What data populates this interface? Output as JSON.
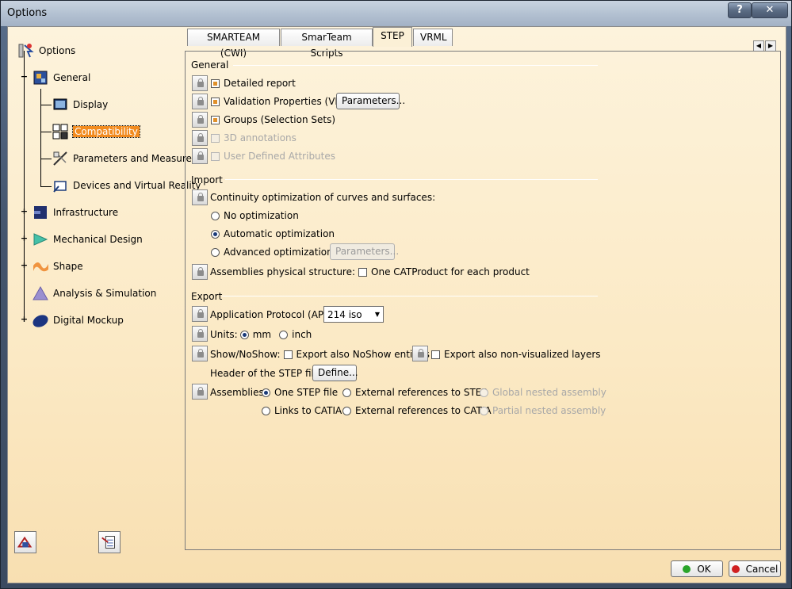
{
  "window": {
    "title": "Options",
    "help": "?",
    "close": "✕"
  },
  "tree": {
    "root": "Options",
    "general": "General",
    "display": "Display",
    "compatibility": "Compatibility",
    "parameters": "Parameters and Measure",
    "devices": "Devices and Virtual Reality",
    "infrastructure": "Infrastructure",
    "mechanical": "Mechanical Design",
    "shape": "Shape",
    "analysis": "Analysis & Simulation",
    "digital": "Digital Mockup"
  },
  "tabs": [
    "SMARTEAM (CWI)",
    "SmarTeam Scripts",
    "STEP",
    "VRML"
  ],
  "general": {
    "title": "General",
    "detailed_report": "Detailed report",
    "validation": "Validation Properties (VP)",
    "parameters_btn": "Parameters...",
    "groups": "Groups (Selection Sets)",
    "annotations": "3D annotations",
    "user_attrs": "User Defined Attributes"
  },
  "import": {
    "title": "Import",
    "continuity": "Continuity optimization of curves and surfaces:",
    "no_opt": "No optimization",
    "auto_opt": "Automatic optimization",
    "adv_opt": "Advanced optimization",
    "parameters_btn": "Parameters...",
    "assemblies_struct": "Assemblies physical structure:",
    "one_catproduct": "One CATProduct for each product"
  },
  "export": {
    "title": "Export",
    "ap_label": "Application Protocol (AP) :",
    "ap_value": "214 iso",
    "units_label": "Units:",
    "mm": "mm",
    "inch": "inch",
    "shownoshow_label": "Show/NoShow:",
    "export_noshow": "Export also NoShow entities",
    "export_nonvis": "Export also non-visualized layers",
    "header_label": "Header of the STEP file :",
    "define_btn": "Define...",
    "assemblies_label": "Assemblies:",
    "one_step": "One STEP file",
    "ext_step": "External references to STEP",
    "global_nested": "Global nested assembly",
    "links_catia": "Links to CATIA",
    "ext_catia": "External references to CATIA",
    "partial_nested": "Partial nested assembly"
  },
  "footer": {
    "ok": "OK",
    "cancel": "Cancel"
  },
  "colors": {
    "accent": "#f28b1e",
    "ok_dot": "#2aa52a",
    "cancel_dot": "#d02020"
  }
}
